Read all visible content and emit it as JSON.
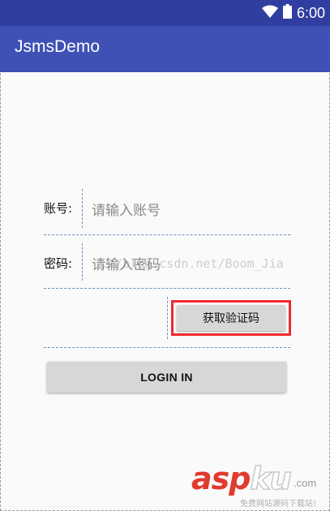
{
  "status_bar": {
    "time": "6:00",
    "icons": [
      "wifi-icon",
      "battery-icon"
    ],
    "color": "#303f9f"
  },
  "app_bar": {
    "title": "JsmsDemo",
    "color": "#3f51b5"
  },
  "form": {
    "account_label": "账号:",
    "account_placeholder": "请输入账号",
    "password_label": "密码:",
    "password_placeholder": "请输入密码",
    "get_code_label": "获取验证码",
    "login_label": "LOGIN IN",
    "highlight_color": "#f0282d"
  },
  "watermark": "://blog.csdn.net/Boom_Jia",
  "site_logo": {
    "main_a": "asp",
    "main_b": "ku",
    "suffix": ".com",
    "tagline": "免费网站源码下载站!"
  }
}
